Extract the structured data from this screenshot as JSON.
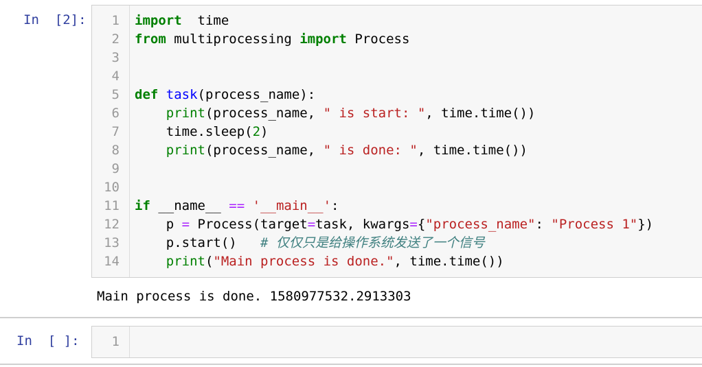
{
  "cells": [
    {
      "prompt": "In  [2]:",
      "lines": [
        [
          "1",
          [
            [
              "kw",
              "import"
            ],
            [
              "",
              "  time"
            ]
          ]
        ],
        [
          "2",
          [
            [
              "kw",
              "from"
            ],
            [
              "",
              " multiprocessing "
            ],
            [
              "kw",
              "import"
            ],
            [
              "",
              " Process"
            ]
          ]
        ],
        [
          "3",
          []
        ],
        [
          "4",
          []
        ],
        [
          "5",
          [
            [
              "kw",
              "def"
            ],
            [
              "",
              " "
            ],
            [
              "fn",
              "task"
            ],
            [
              "",
              "(process_name):"
            ]
          ]
        ],
        [
          "6",
          [
            [
              "",
              "    "
            ],
            [
              "builtin",
              "print"
            ],
            [
              "",
              "(process_name, "
            ],
            [
              "str",
              "\" is start: \""
            ],
            [
              "",
              ", time.time())"
            ]
          ]
        ],
        [
          "7",
          [
            [
              "",
              "    time.sleep("
            ],
            [
              "num",
              "2"
            ],
            [
              "",
              ")"
            ]
          ]
        ],
        [
          "8",
          [
            [
              "",
              "    "
            ],
            [
              "builtin",
              "print"
            ],
            [
              "",
              "(process_name, "
            ],
            [
              "str",
              "\" is done: \""
            ],
            [
              "",
              ", time.time())"
            ]
          ]
        ],
        [
          "9",
          []
        ],
        [
          "10",
          []
        ],
        [
          "11",
          [
            [
              "kw",
              "if"
            ],
            [
              "",
              " __name__ "
            ],
            [
              "op",
              "=="
            ],
            [
              "",
              " "
            ],
            [
              "str",
              "'__main__'"
            ],
            [
              "",
              ":"
            ]
          ]
        ],
        [
          "12",
          [
            [
              "",
              "    p "
            ],
            [
              "op",
              "="
            ],
            [
              "",
              " Process(target"
            ],
            [
              "op",
              "="
            ],
            [
              "",
              "task, kwargs"
            ],
            [
              "op",
              "="
            ],
            [
              "",
              "{"
            ],
            [
              "str",
              "\"process_name\""
            ],
            [
              "",
              ": "
            ],
            [
              "str",
              "\"Process 1\""
            ],
            [
              "",
              "})"
            ]
          ]
        ],
        [
          "13",
          [
            [
              "",
              "    p.start()   "
            ],
            [
              "cm",
              "# 仅仅只是给操作系统发送了一个信号"
            ]
          ]
        ],
        [
          "14",
          [
            [
              "",
              "    "
            ],
            [
              "builtin",
              "print"
            ],
            [
              "",
              "("
            ],
            [
              "str",
              "\"Main process is done.\""
            ],
            [
              "",
              ", time.time())"
            ]
          ]
        ]
      ],
      "output": "Main process is done. 1580977532.2913303"
    },
    {
      "prompt": "In  [ ]:",
      "lines": [
        [
          "1",
          []
        ]
      ]
    }
  ]
}
